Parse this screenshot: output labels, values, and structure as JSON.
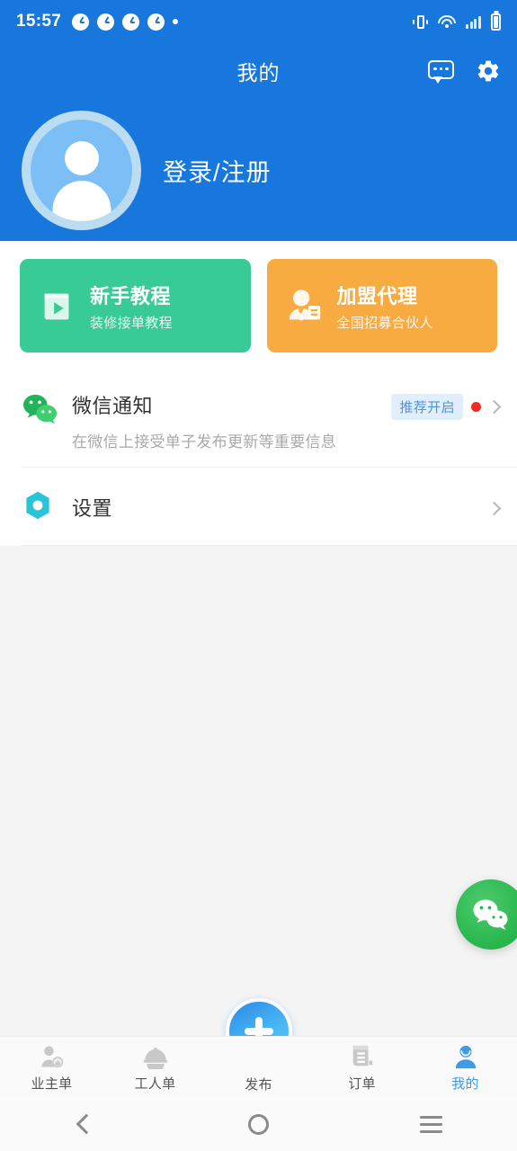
{
  "status_bar": {
    "time": "15:57",
    "app_icon_count": 4,
    "icons": [
      "vibrate-icon",
      "wifi-icon",
      "signal-icon",
      "battery-icon"
    ]
  },
  "header": {
    "title": "我的",
    "chat_icon": "chat-bubble-icon",
    "settings_icon": "gear-icon"
  },
  "profile": {
    "login_label": "登录/注册",
    "avatar_icon": "user-avatar-placeholder"
  },
  "promos": [
    {
      "title": "新手教程",
      "subtitle": "装修接单教程",
      "color": "#38cb96",
      "icon": "book-play-icon"
    },
    {
      "title": "加盟代理",
      "subtitle": "全国招募合伙人",
      "color": "#f8ab41",
      "icon": "agent-person-icon"
    }
  ],
  "list": [
    {
      "title": "微信通知",
      "subtitle": "在微信上接受单子发布更新等重要信息",
      "badge": "推荐开启",
      "badge_color": "#4a93e3",
      "badge_bg": "#e1eefc",
      "has_red_dot": true,
      "icon": "wechat-icon"
    },
    {
      "title": "设置",
      "subtitle": "",
      "icon": "settings-hex-icon"
    }
  ],
  "floating_button": {
    "icon": "wechat-icon",
    "color": "#2bb84f"
  },
  "tabbar": {
    "items": [
      {
        "label": "业主单",
        "icon": "owner-person-home-icon",
        "active": false
      },
      {
        "label": "工人单",
        "icon": "worker-helmet-icon",
        "active": false
      },
      {
        "label": "发布",
        "icon": "plus-icon",
        "active": false
      },
      {
        "label": "订单",
        "icon": "order-document-icon",
        "active": false
      },
      {
        "label": "我的",
        "icon": "profile-person-icon",
        "active": true
      }
    ],
    "active_color": "#3f9ae8"
  },
  "android_nav": {
    "back": "back-icon",
    "home": "home-icon",
    "recents": "recents-icon"
  }
}
